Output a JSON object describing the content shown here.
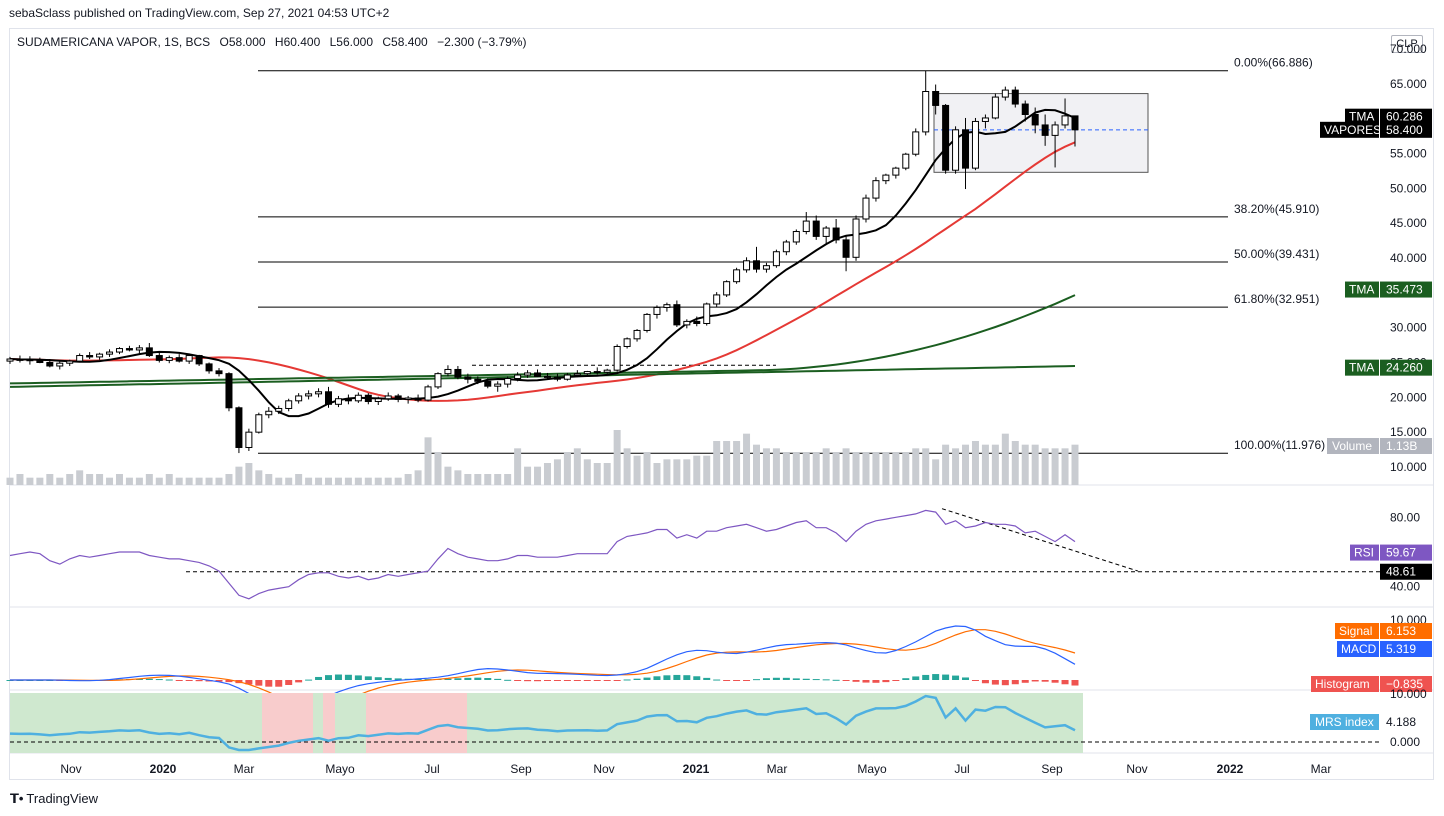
{
  "header": {
    "published": "sebaSclass published on TradingView.com, Sep 27, 2021 04:53 UTC+2",
    "legend": {
      "symbol": "SUDAMERICANA VAPOR, 1S, BCS",
      "open": "O58.000",
      "high": "H60.400",
      "low": "L56.000",
      "close": "C58.400",
      "change": "−2.300 (−3.79%)"
    },
    "currency": "CLP"
  },
  "footer": {
    "brand": "TradingView",
    "brand_icon": "tradingview-logo-icon"
  },
  "colors": {
    "up_candle": "#ffffff",
    "down_candle": "#000000",
    "tma_fast": "#000000",
    "tma_mid_red": "#e53935",
    "tma_green": "#1b5e20",
    "volume": "#c9ccd1",
    "rsi": "#7e57c2",
    "signal": "#ff6d00",
    "macd": "#2962ff",
    "hist_up": "#26a69a",
    "hist_down": "#ef5350",
    "mrs": "#4fb0e0",
    "mrs_bg_green": "#cfe8cf",
    "mrs_bg_red": "#f8cccc"
  },
  "chart_data": [
    {
      "type": "candlestick",
      "title": "SUDAMERICANA VAPOR, 1S, BCS",
      "y_axis_ticks": [
        "70.000",
        "65.000",
        "60.000",
        "55.000",
        "50.000",
        "45.000",
        "40.000",
        "35.000",
        "30.000",
        "25.000",
        "20.000",
        "15.000",
        "10.000"
      ],
      "ylim": [
        9,
        72
      ],
      "x_axis_ticks": [
        "Nov",
        "2020",
        "Mar",
        "Mayo",
        "Jul",
        "Sep",
        "Nov",
        "2021",
        "Mar",
        "Mayo",
        "Jul",
        "Sep",
        "Nov",
        "2022",
        "Mar"
      ],
      "ohlc": [
        [
          25.2,
          25.8,
          24.8,
          25.5
        ],
        [
          25.5,
          26.0,
          25.0,
          25.3
        ],
        [
          25.3,
          25.9,
          24.7,
          25.4
        ],
        [
          25.4,
          25.7,
          24.9,
          25.0
        ],
        [
          25.0,
          25.5,
          24.3,
          24.5
        ],
        [
          24.5,
          25.2,
          24.0,
          24.9
        ],
        [
          24.9,
          25.4,
          24.5,
          25.2
        ],
        [
          25.2,
          26.3,
          25.0,
          26.0
        ],
        [
          26.0,
          26.5,
          25.5,
          25.8
        ],
        [
          25.8,
          26.4,
          25.4,
          26.2
        ],
        [
          26.2,
          26.9,
          25.8,
          26.5
        ],
        [
          26.5,
          27.2,
          26.2,
          27.0
        ],
        [
          27.0,
          27.4,
          26.6,
          26.8
        ],
        [
          26.8,
          27.5,
          26.3,
          27.1
        ],
        [
          27.1,
          27.8,
          25.8,
          26.0
        ],
        [
          26.0,
          26.6,
          25.0,
          25.3
        ],
        [
          25.3,
          26.0,
          24.9,
          25.7
        ],
        [
          25.7,
          26.2,
          25.0,
          25.2
        ],
        [
          25.2,
          26.3,
          24.8,
          26.0
        ],
        [
          26.0,
          26.1,
          24.5,
          24.8
        ],
        [
          24.8,
          25.0,
          23.4,
          23.8
        ],
        [
          23.8,
          24.2,
          23.0,
          23.4
        ],
        [
          23.4,
          23.6,
          18.0,
          18.5
        ],
        [
          18.5,
          18.7,
          12.0,
          12.8
        ],
        [
          12.8,
          15.5,
          12.3,
          15.0
        ],
        [
          15.0,
          17.8,
          14.8,
          17.5
        ],
        [
          17.5,
          18.6,
          17.0,
          18.0
        ],
        [
          18.0,
          18.8,
          17.6,
          18.4
        ],
        [
          18.4,
          19.8,
          18.0,
          19.5
        ],
        [
          19.5,
          20.6,
          19.1,
          20.2
        ],
        [
          20.2,
          21.0,
          19.7,
          20.5
        ],
        [
          20.5,
          21.3,
          20.0,
          20.8
        ],
        [
          20.8,
          21.5,
          18.5,
          19.0
        ],
        [
          19.0,
          20.2,
          18.6,
          19.8
        ],
        [
          19.8,
          20.4,
          19.0,
          19.5
        ],
        [
          19.5,
          20.7,
          19.2,
          20.3
        ],
        [
          20.3,
          20.6,
          19.0,
          19.4
        ],
        [
          19.4,
          20.1,
          18.9,
          19.8
        ],
        [
          19.8,
          20.7,
          19.5,
          20.2
        ],
        [
          20.2,
          20.5,
          19.3,
          19.7
        ],
        [
          19.7,
          20.2,
          19.1,
          19.9
        ],
        [
          19.9,
          20.4,
          19.3,
          19.6
        ],
        [
          19.6,
          21.8,
          19.4,
          21.5
        ],
        [
          21.5,
          23.6,
          21.2,
          23.4
        ],
        [
          23.4,
          24.6,
          23.0,
          24.0
        ],
        [
          24.0,
          24.5,
          22.6,
          22.9
        ],
        [
          22.9,
          23.4,
          22.0,
          22.6
        ],
        [
          22.6,
          23.0,
          21.9,
          22.3
        ],
        [
          22.3,
          22.7,
          21.3,
          21.6
        ],
        [
          21.6,
          22.3,
          20.8,
          21.9
        ],
        [
          21.9,
          23.0,
          21.4,
          22.7
        ],
        [
          22.7,
          23.6,
          22.3,
          23.2
        ],
        [
          23.2,
          23.9,
          22.8,
          23.5
        ],
        [
          23.5,
          24.0,
          22.9,
          23.0
        ],
        [
          23.0,
          23.5,
          22.5,
          22.9
        ],
        [
          22.9,
          23.4,
          22.3,
          22.6
        ],
        [
          22.6,
          23.5,
          22.4,
          23.2
        ],
        [
          23.2,
          23.9,
          22.9,
          23.4
        ],
        [
          23.4,
          23.8,
          23.0,
          23.7
        ],
        [
          23.7,
          24.3,
          23.3,
          23.6
        ],
        [
          23.6,
          24.1,
          23.2,
          23.9
        ],
        [
          23.9,
          27.6,
          23.7,
          27.3
        ],
        [
          27.3,
          28.6,
          27.0,
          28.4
        ],
        [
          28.4,
          29.8,
          28.0,
          29.6
        ],
        [
          29.6,
          32.1,
          29.3,
          31.9
        ],
        [
          31.9,
          33.2,
          31.3,
          32.9
        ],
        [
          32.9,
          33.6,
          32.3,
          33.3
        ],
        [
          33.3,
          33.9,
          30.1,
          30.4
        ],
        [
          30.4,
          31.2,
          29.9,
          30.9
        ],
        [
          30.9,
          31.6,
          30.2,
          30.6
        ],
        [
          30.6,
          33.6,
          30.3,
          33.4
        ],
        [
          33.4,
          35.1,
          32.9,
          34.7
        ],
        [
          34.7,
          36.8,
          34.4,
          36.6
        ],
        [
          36.6,
          38.6,
          36.3,
          38.3
        ],
        [
          38.3,
          40.1,
          37.9,
          39.6
        ],
        [
          39.6,
          41.6,
          37.9,
          38.4
        ],
        [
          38.4,
          39.3,
          37.9,
          38.9
        ],
        [
          38.9,
          41.2,
          38.6,
          40.9
        ],
        [
          40.9,
          42.6,
          40.4,
          42.3
        ],
        [
          42.3,
          44.1,
          41.9,
          43.8
        ],
        [
          43.8,
          46.6,
          43.4,
          45.3
        ],
        [
          45.3,
          46.1,
          42.6,
          43.1
        ],
        [
          43.1,
          44.6,
          42.1,
          44.3
        ],
        [
          44.3,
          45.6,
          42.1,
          42.6
        ],
        [
          42.6,
          43.1,
          38.1,
          40.1
        ],
        [
          40.1,
          46.1,
          39.6,
          45.6
        ],
        [
          45.6,
          49.1,
          45.1,
          48.6
        ],
        [
          48.6,
          51.6,
          48.1,
          51.1
        ],
        [
          51.1,
          52.1,
          50.6,
          51.9
        ],
        [
          51.9,
          53.1,
          51.4,
          52.9
        ],
        [
          52.9,
          55.1,
          52.6,
          54.9
        ],
        [
          54.9,
          58.6,
          54.6,
          58.1
        ],
        [
          58.1,
          66.9,
          57.6,
          63.9
        ],
        [
          63.9,
          64.9,
          60.6,
          61.9
        ],
        [
          61.9,
          62.1,
          52.1,
          52.6
        ],
        [
          52.6,
          58.9,
          52.1,
          58.4
        ],
        [
          58.4,
          60.1,
          49.9,
          52.9
        ],
        [
          52.9,
          60.1,
          52.6,
          59.6
        ],
        [
          59.6,
          60.6,
          58.6,
          60.1
        ],
        [
          60.1,
          63.6,
          59.9,
          63.1
        ],
        [
          63.1,
          64.6,
          62.6,
          64.1
        ],
        [
          64.1,
          64.6,
          61.6,
          62.1
        ],
        [
          62.1,
          62.6,
          59.6,
          60.6
        ],
        [
          60.6,
          61.6,
          57.9,
          59.1
        ],
        [
          59.1,
          60.6,
          56.1,
          57.6
        ],
        [
          57.6,
          59.6,
          53.0,
          59.1
        ],
        [
          59.1,
          62.9,
          58.6,
          60.4
        ],
        [
          60.4,
          60.4,
          56.0,
          58.4
        ]
      ],
      "volume_scale_ref": "max≈20% of price pane height",
      "volume_relative": [
        2,
        3,
        2,
        2,
        3,
        2,
        3,
        4,
        3,
        3,
        2,
        3,
        2,
        2,
        3,
        2,
        3,
        2,
        2,
        2,
        2,
        2,
        3,
        5,
        6,
        4,
        3,
        2,
        2,
        3,
        2,
        2,
        2,
        2,
        2,
        2,
        2,
        2,
        2,
        2,
        3,
        4,
        13,
        9,
        5,
        4,
        3,
        3,
        3,
        3,
        3,
        10,
        5,
        5,
        6,
        7,
        9,
        10,
        7,
        6,
        6,
        15,
        10,
        8,
        9,
        6,
        7,
        7,
        7,
        8,
        8,
        12,
        12,
        12,
        14,
        11,
        10,
        10,
        9,
        9,
        9,
        9,
        10,
        9,
        10,
        9,
        9,
        9,
        9,
        9,
        9,
        10,
        10,
        7,
        11,
        10,
        11,
        12,
        11,
        11,
        14,
        12,
        11,
        11,
        10,
        10,
        10,
        11
      ],
      "moving_averages": [
        {
          "name": "TMA",
          "value_label": "60.286",
          "color": "#000000"
        },
        {
          "name": "TMA",
          "value_label": "35.473",
          "color": "#1b5e20"
        },
        {
          "name": "TMA",
          "value_label": "24.260",
          "color": "#1b5e20"
        }
      ],
      "price_tag": {
        "name": "VAPORES",
        "value_label": "58.400"
      },
      "volume_tag": {
        "name": "Volume",
        "value_label": "1.13B"
      },
      "fibonacci": [
        {
          "label": "0.00%(66.886)",
          "value": 66.886
        },
        {
          "label": "38.20%(45.910)",
          "value": 45.91
        },
        {
          "label": "50.00%(39.431)",
          "value": 39.431
        },
        {
          "label": "61.80%(32.951)",
          "value": 32.951
        },
        {
          "label": "100.00%(11.976)",
          "value": 11.976
        }
      ]
    },
    {
      "type": "line",
      "name": "RSI",
      "y_axis_ticks": [
        "80.00",
        "40.00"
      ],
      "ylim": [
        28,
        92
      ],
      "values": [
        58,
        59,
        60,
        59,
        55,
        53,
        56,
        58,
        57,
        58,
        59,
        60,
        60,
        60,
        58,
        57,
        56,
        56,
        55,
        54,
        52,
        49,
        42,
        35,
        33,
        36,
        38,
        39,
        40,
        44,
        47,
        48,
        48,
        46,
        45,
        46,
        44,
        45,
        47,
        46,
        47,
        48,
        49,
        56,
        62,
        59,
        57,
        56,
        55,
        55,
        56,
        58,
        58,
        57,
        57,
        57,
        58,
        59,
        59,
        59,
        59,
        66,
        69,
        70,
        71,
        73,
        73,
        68,
        70,
        68,
        72,
        72,
        74,
        75,
        76,
        74,
        72,
        73,
        75,
        77,
        78,
        74,
        74,
        71,
        66,
        72,
        76,
        78,
        79,
        80,
        81,
        82,
        84,
        83,
        76,
        78,
        74,
        75,
        77,
        76,
        76,
        75,
        71,
        72,
        69,
        66,
        70,
        66
      ],
      "level_line": 48.61,
      "tags": [
        {
          "name": "RSI",
          "value_label": "59.67"
        },
        {
          "name": "",
          "value_label": "48.61"
        }
      ]
    },
    {
      "type": "line",
      "name": "MACD",
      "y_axis_ticks": [
        "10.000"
      ],
      "series": [
        {
          "name": "Signal",
          "value_label": "6.153"
        },
        {
          "name": "MACD",
          "value_label": "5.319"
        },
        {
          "name": "Histogram",
          "value_label": "−0.835"
        }
      ]
    },
    {
      "type": "area",
      "name": "MRS index",
      "y_axis_ticks": [
        "10.000",
        "0.000"
      ],
      "tag": {
        "name": "MRS index",
        "value_label": "4.188"
      }
    }
  ]
}
